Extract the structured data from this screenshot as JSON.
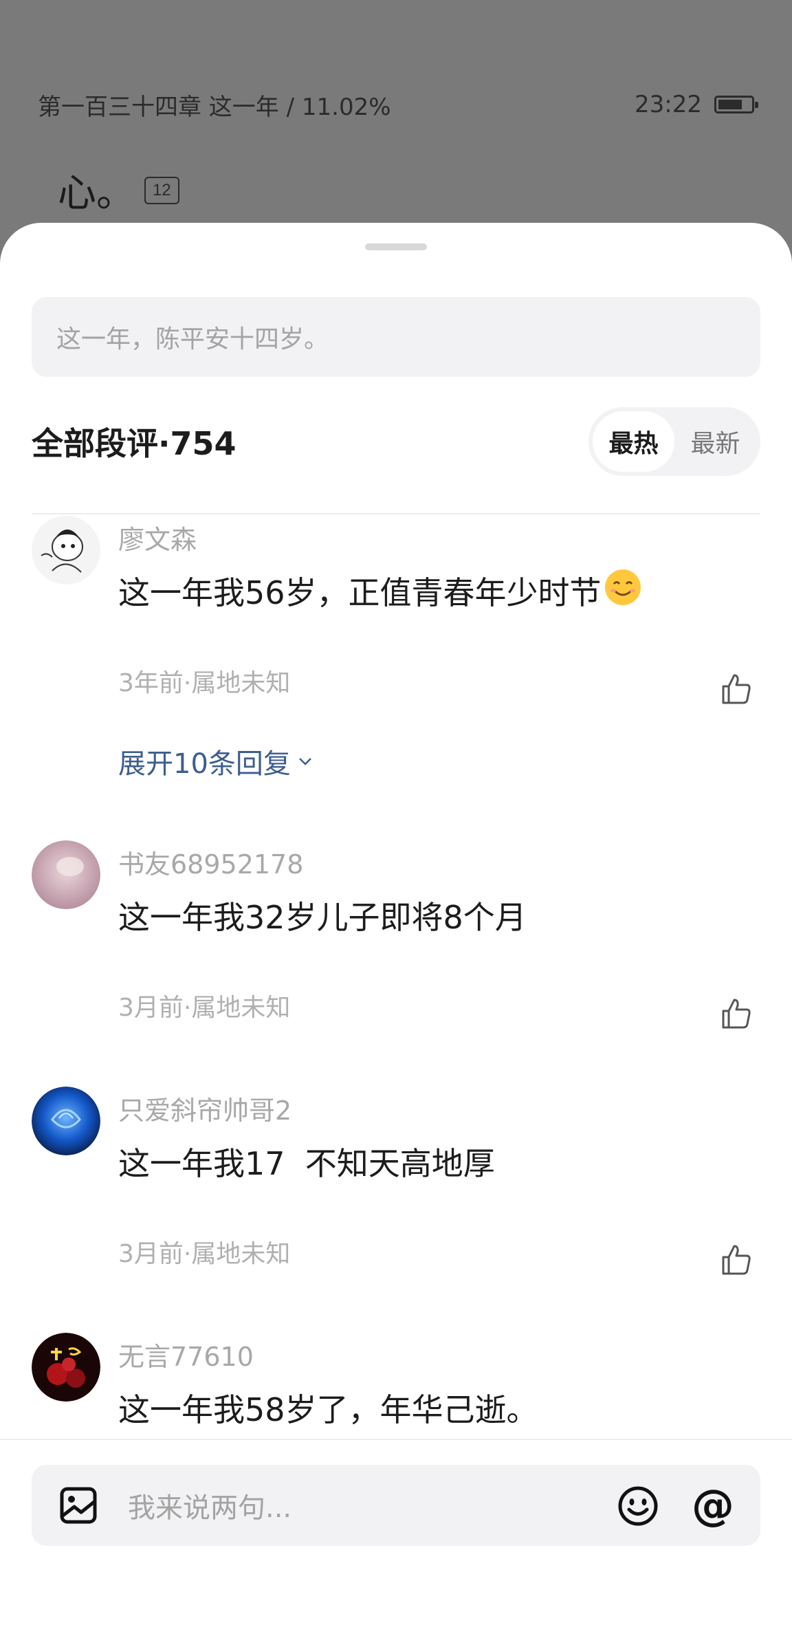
{
  "reader": {
    "chapter_progress": "第一百三十四章 这一年 / 11.02%",
    "time": "23:22",
    "text": "心。",
    "para_comment_count": "12"
  },
  "sheet": {
    "quote": "这一年，陈平安十四岁。",
    "title": "全部段评·754",
    "sort": {
      "hot": "最热",
      "new": "最新",
      "active": "hot"
    }
  },
  "comments": [
    {
      "user": "廖文森",
      "text": "这一年我56岁，正值青春年少时节",
      "emoji": "smiling-face-emoji",
      "meta": "3年前·属地未知",
      "expand": "展开10条回复"
    },
    {
      "user": "书友68952178",
      "text": "这一年我32岁儿子即将8个月",
      "meta": "3月前·属地未知"
    },
    {
      "user": "只爱斜帘帅哥2",
      "text": "这一年我17  不知天高地厚",
      "meta": "3月前·属地未知"
    },
    {
      "user": "无言77610",
      "text": "这一年我58岁了，年华己逝。"
    }
  ],
  "composer": {
    "placeholder": "我来说两句...",
    "at_symbol": "@"
  },
  "colors": {
    "accent_link": "#3d5e8f",
    "dim_overlay": "#7a7a7a",
    "input_bg": "#f2f2f4"
  }
}
